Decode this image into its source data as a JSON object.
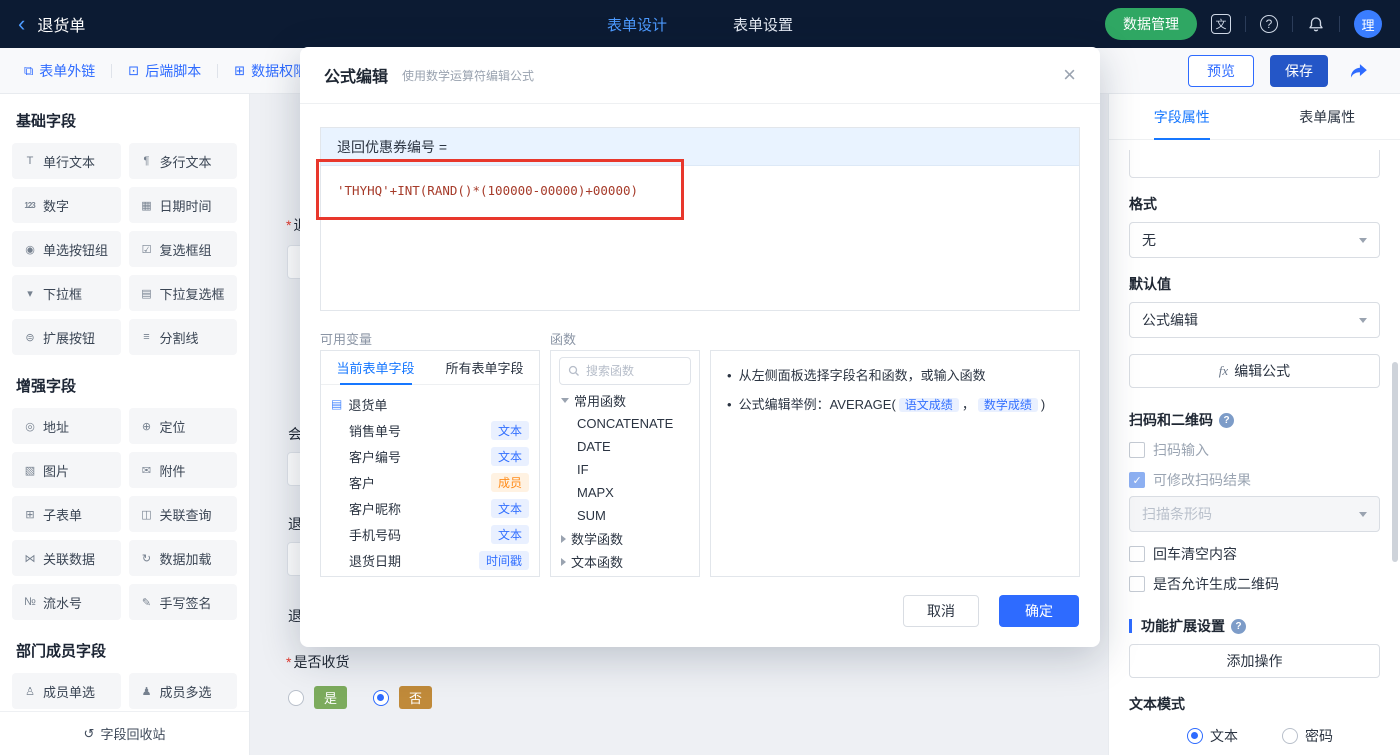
{
  "icons": {
    "back": "‹",
    "translate": "文",
    "help": "?",
    "doc": "▤",
    "recycle": "↺",
    "bullet": "•",
    "fx": "fx"
  },
  "header": {
    "title": "退货单",
    "nav": [
      {
        "label": "表单设计"
      },
      {
        "label": "表单设置"
      }
    ],
    "data_manage": "数据管理",
    "avatar": "理"
  },
  "toolbar": {
    "links": [
      {
        "icon": "⧉",
        "label": "表单外链"
      },
      {
        "icon": "⊡",
        "label": "后端脚本"
      },
      {
        "icon": "⊞",
        "label": "数据权限"
      }
    ],
    "preview": "预览",
    "save": "保存"
  },
  "sidebar": {
    "sections": [
      {
        "title": "基础字段",
        "items": [
          {
            "icon": "T",
            "label": "单行文本"
          },
          {
            "icon": "¶",
            "label": "多行文本"
          },
          {
            "icon": "123",
            "label": "数字"
          },
          {
            "icon": "▦",
            "label": "日期时间"
          },
          {
            "icon": "◉",
            "label": "单选按钮组"
          },
          {
            "icon": "☑",
            "label": "复选框组"
          },
          {
            "icon": "▾",
            "label": "下拉框"
          },
          {
            "icon": "▤",
            "label": "下拉复选框"
          },
          {
            "icon": "⊜",
            "label": "扩展按钮"
          },
          {
            "icon": "≡",
            "label": "分割线"
          }
        ]
      },
      {
        "title": "增强字段",
        "items": [
          {
            "icon": "◎",
            "label": "地址"
          },
          {
            "icon": "⊕",
            "label": "定位"
          },
          {
            "icon": "▧",
            "label": "图片"
          },
          {
            "icon": "✉",
            "label": "附件"
          },
          {
            "icon": "⊞",
            "label": "子表单"
          },
          {
            "icon": "◫",
            "label": "关联查询"
          },
          {
            "icon": "⋈",
            "label": "关联数据"
          },
          {
            "icon": "↻",
            "label": "数据加载"
          },
          {
            "icon": "№",
            "label": "流水号"
          },
          {
            "icon": "✎",
            "label": "手写签名"
          }
        ]
      },
      {
        "title": "部门成员字段",
        "items": [
          {
            "icon": "♙",
            "label": "成员单选"
          },
          {
            "icon": "♟",
            "label": "成员多选"
          }
        ]
      }
    ],
    "recycle_label": "字段回收站"
  },
  "canvas": {
    "fragments": [
      {
        "required": "*",
        "label": "退"
      },
      {
        "required": "",
        "label": "会"
      },
      {
        "required": "",
        "label": "退"
      },
      {
        "required": "",
        "label": "退"
      }
    ],
    "receive": {
      "required": "*",
      "label": "是否收货",
      "yes": "是",
      "no": "否"
    }
  },
  "modal": {
    "title": "公式编辑",
    "subtitle": "使用数学运算符编辑公式",
    "close": "×",
    "target": "退回优惠券编号 =",
    "formula": "'THYHQ'+INT(RAND()*(100000-00000)+00000)",
    "variables": {
      "label": "可用变量",
      "tabs": [
        {
          "label": "当前表单字段"
        },
        {
          "label": "所有表单字段"
        }
      ],
      "root": "退货单",
      "fields": [
        {
          "name": "销售单号",
          "tag": "文本"
        },
        {
          "name": "客户编号",
          "tag": "文本"
        },
        {
          "name": "客户",
          "tag": "成员"
        },
        {
          "name": "客户昵称",
          "tag": "文本"
        },
        {
          "name": "手机号码",
          "tag": "文本"
        },
        {
          "name": "退货日期",
          "tag": "时间戳"
        }
      ]
    },
    "functions": {
      "label": "函数",
      "search_placeholder": "搜索函数",
      "groups": [
        {
          "name": "常用函数",
          "items": [
            "CONCATENATE",
            "DATE",
            "IF",
            "MAPX",
            "SUM"
          ]
        },
        {
          "name": "数学函数"
        },
        {
          "name": "文本函数"
        }
      ]
    },
    "hints": {
      "line1": "从左侧面板选择字段名和函数，或输入函数",
      "line2_prefix": "公式编辑举例：AVERAGE(",
      "tag1": "语文成绩",
      "separator": "，",
      "tag2": "数学成绩",
      "line2_suffix": ")"
    },
    "cancel": "取消",
    "ok": "确定"
  },
  "right_panel": {
    "tabs": [
      {
        "label": "字段属性"
      },
      {
        "label": "表单属性"
      }
    ],
    "format_label": "格式",
    "format_value": "无",
    "default_label": "默认值",
    "default_value": "公式编辑",
    "edit_formula": "编辑公式",
    "scan_section": "扫码和二维码",
    "scan_input": "扫码输入",
    "scan_editable": "可修改扫码结果",
    "scan_barcode": "扫描条形码",
    "enter_clear": "回车清空内容",
    "allow_qr": "是否允许生成二维码",
    "ext_section": "功能扩展设置",
    "add_action": "添加操作",
    "text_mode": "文本模式",
    "mode_text": "文本",
    "mode_password": "密码"
  }
}
